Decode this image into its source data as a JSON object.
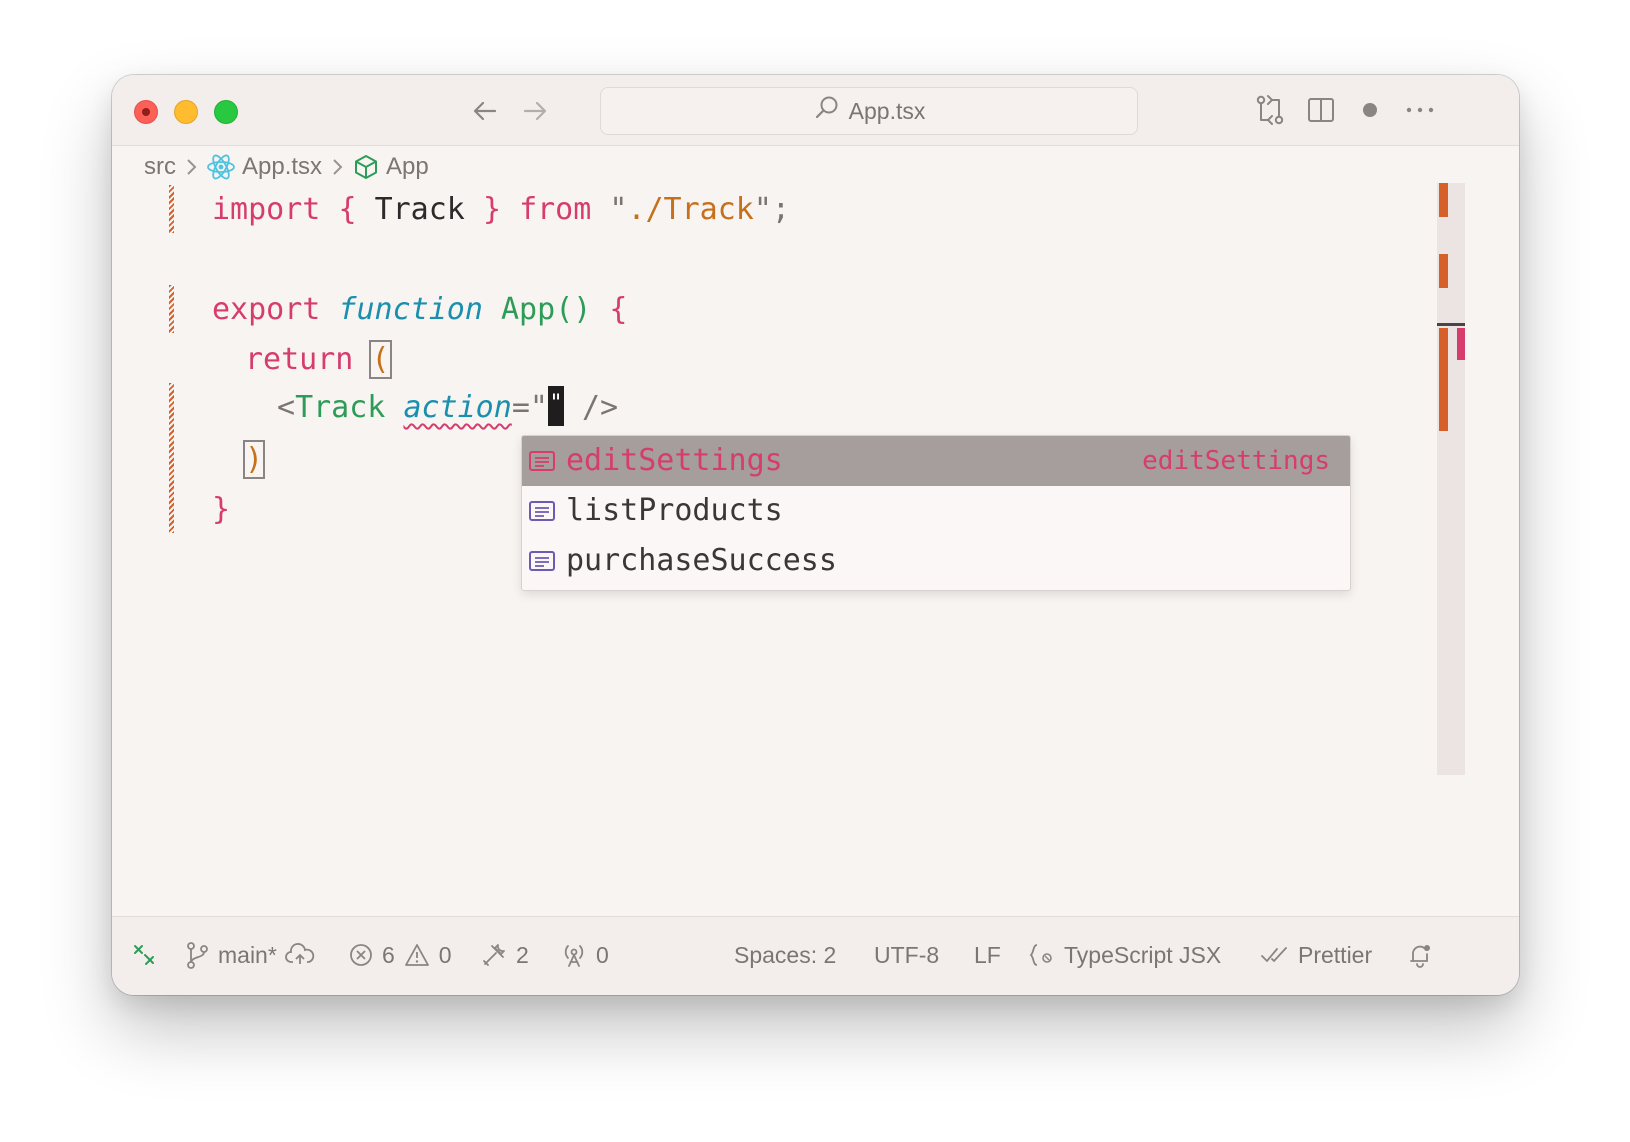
{
  "window": {
    "search_label": "App.tsx"
  },
  "breadcrumb": {
    "folder": "src",
    "file": "App.tsx",
    "symbol": "App"
  },
  "code": {
    "line1": {
      "import_kw": "import",
      "brace_open": "{",
      "name": "Track",
      "brace_close": "}",
      "from_kw": "from",
      "quote_open": "\"",
      "path": "./Track",
      "quote_close": "\";"
    },
    "line3": {
      "export_kw": "export",
      "function_kw": "function",
      "fn_name": "App",
      "parens": "()",
      "brace": "{"
    },
    "line4": {
      "return_kw": "return",
      "paren": "("
    },
    "line5": {
      "tag_open": "<",
      "tag_name": "Track",
      "attr": "action",
      "eq": "=\"",
      "cursor_char": "\"",
      "close": "/>"
    },
    "line6": {
      "paren": ")"
    },
    "line7": {
      "brace": "}"
    }
  },
  "suggestions": [
    {
      "label": "editSettings",
      "detail": "editSettings",
      "selected": true
    },
    {
      "label": "listProducts",
      "detail": "",
      "selected": false
    },
    {
      "label": "purchaseSuccess",
      "detail": "",
      "selected": false
    }
  ],
  "status": {
    "branch": "main*",
    "errors": "6",
    "warnings": "0",
    "tools": "2",
    "ports": "0",
    "spaces": "Spaces: 2",
    "encoding": "UTF-8",
    "eol": "LF",
    "language": "TypeScript JSX",
    "formatter": "Prettier"
  },
  "colors": {
    "keyword": "#d63d6e",
    "function_keyword": "#1a8fae",
    "function_name": "#2d9c58",
    "string": "#c7701a",
    "modified_gutter": "#d6602a",
    "selected_suggestion_bg": "#a59e9d"
  }
}
